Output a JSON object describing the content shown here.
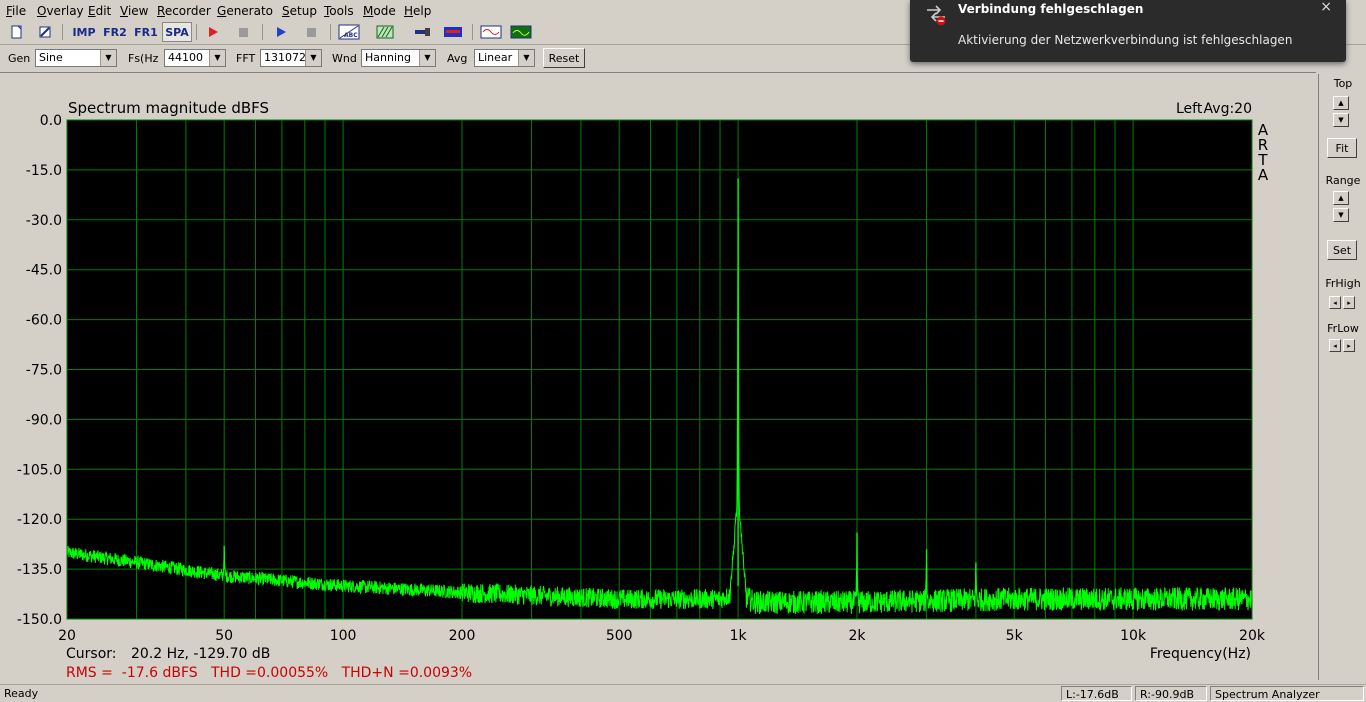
{
  "menu": [
    {
      "label": "File",
      "accel": "F",
      "rest": "ile"
    },
    {
      "label": "Overlay",
      "accel": "O",
      "rest": "verlay"
    },
    {
      "label": "Edit",
      "accel": "E",
      "rest": "dit"
    },
    {
      "label": "View",
      "accel": "V",
      "rest": "iew"
    },
    {
      "label": "Recorder",
      "accel": "R",
      "rest": "ecorder"
    },
    {
      "label": "Generator",
      "accel": "G",
      "rest": "enerato"
    },
    {
      "label": "Setup",
      "accel": "S",
      "rest": "etup"
    },
    {
      "label": "Tools",
      "accel": "T",
      "rest": "ools"
    },
    {
      "label": "Mode",
      "accel": "M",
      "rest": "ode"
    },
    {
      "label": "Help",
      "accel": "H",
      "rest": "elp"
    }
  ],
  "toolbar": {
    "imp": "IMP",
    "fr2": "FR2",
    "fr1": "FR1",
    "spa": "SPA",
    "abc": "ABC"
  },
  "controls": {
    "gen_label": "Gen",
    "gen_value": "Sine",
    "fs_label": "Fs(Hz",
    "fs_value": "44100",
    "fft_label": "FFT",
    "fft_value": "131072",
    "wnd_label": "Wnd",
    "wnd_value": "Hanning",
    "avg_label": "Avg",
    "avg_value": "Linear",
    "reset": "Reset"
  },
  "right_panel": {
    "top": "Top",
    "fit": "Fit",
    "range": "Range",
    "set": "Set",
    "frhigh": "FrHigh",
    "frlow": "FrLow"
  },
  "status": {
    "ready": "Ready",
    "left": "L:-17.6dB",
    "right": "R:-90.9dB",
    "mode": "Spectrum Analyzer"
  },
  "notification": {
    "title": "Verbindung fehlgeschlagen",
    "body": "Aktivierung der Netzwerkverbindung ist fehlgeschlagen",
    "close": "×"
  },
  "chart_data": {
    "type": "line",
    "title": "Spectrum magnitude dBFS",
    "channel": "Left",
    "avg": "Avg:20",
    "brand": "ARTA",
    "xlabel": "Frequency(Hz)",
    "x_scale": "log",
    "xlim": [
      20,
      20000
    ],
    "ylim": [
      -150,
      0
    ],
    "x_ticks": [
      {
        "v": 20,
        "label": "20"
      },
      {
        "v": 50,
        "label": "50"
      },
      {
        "v": 100,
        "label": "100"
      },
      {
        "v": 200,
        "label": "200"
      },
      {
        "v": 500,
        "label": "500"
      },
      {
        "v": 1000,
        "label": "1k"
      },
      {
        "v": 2000,
        "label": "2k"
      },
      {
        "v": 5000,
        "label": "5k"
      },
      {
        "v": 10000,
        "label": "10k"
      },
      {
        "v": 20000,
        "label": "20k"
      }
    ],
    "y_ticks": [
      {
        "v": 0,
        "label": "0.0"
      },
      {
        "v": -15,
        "label": "-15.0"
      },
      {
        "v": -30,
        "label": "-30.0"
      },
      {
        "v": -45,
        "label": "-45.0"
      },
      {
        "v": -60,
        "label": "-60.0"
      },
      {
        "v": -75,
        "label": "-75.0"
      },
      {
        "v": -90,
        "label": "-90.0"
      },
      {
        "v": -105,
        "label": "-105.0"
      },
      {
        "v": -120,
        "label": "-120.0"
      },
      {
        "v": -135,
        "label": "-135.0"
      },
      {
        "v": -150,
        "label": "-150.0"
      }
    ],
    "grid": true,
    "colors": {
      "background": "#000000",
      "grid": "#008000",
      "trace": "#00ff00",
      "axis_text": "#000000",
      "readout": "#cc0000"
    },
    "series": [
      {
        "noise_floor": [
          [
            20,
            -130
          ],
          [
            30,
            -133
          ],
          [
            50,
            -137
          ],
          [
            100,
            -140
          ],
          [
            200,
            -142
          ],
          [
            500,
            -144
          ],
          [
            900,
            -144
          ],
          [
            1000,
            -142
          ],
          [
            1100,
            -145
          ],
          [
            2000,
            -145
          ],
          [
            5000,
            -144
          ],
          [
            10000,
            -144
          ],
          [
            20000,
            -144
          ]
        ],
        "peaks": [
          {
            "f": 50,
            "db": -128
          },
          {
            "f": 1000,
            "db": -17.6
          },
          {
            "f": 2000,
            "db": -124
          },
          {
            "f": 3000,
            "db": -129
          },
          {
            "f": 4000,
            "db": -133
          }
        ]
      }
    ],
    "cursor_label": "Cursor:",
    "cursor_value": "20.2 Hz, -129.70 dB",
    "readout": "RMS =  -17.6 dBFS   THD =0.00055%   THD+N =0.0093%"
  }
}
